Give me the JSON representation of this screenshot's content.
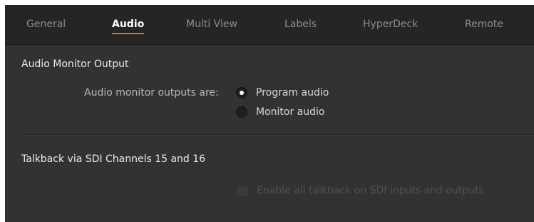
{
  "tabs": [
    {
      "label": "General",
      "active": false
    },
    {
      "label": "Audio",
      "active": true
    },
    {
      "label": "Multi View",
      "active": false
    },
    {
      "label": "Labels",
      "active": false
    },
    {
      "label": "HyperDeck",
      "active": false
    },
    {
      "label": "Remote",
      "active": false
    }
  ],
  "colors": {
    "accent": "#e8720c",
    "panel_bg": "#323232",
    "tabbar_bg": "#252525"
  },
  "audio_monitor": {
    "section_title": "Audio Monitor Output",
    "field_label": "Audio monitor outputs are:",
    "options": [
      {
        "label": "Program audio",
        "selected": true
      },
      {
        "label": "Monitor audio",
        "selected": false
      }
    ]
  },
  "talkback": {
    "section_title": "Talkback via SDI Channels 15 and 16",
    "checkbox_label": "Enable all talkback on SDI inputs and outputs",
    "checked": false,
    "enabled": false
  }
}
